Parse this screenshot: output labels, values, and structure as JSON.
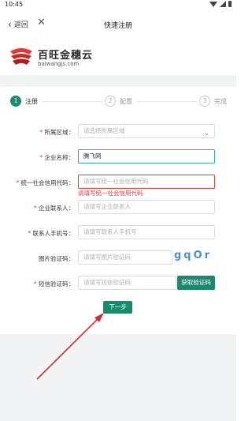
{
  "status": {
    "time": "10:45"
  },
  "nav": {
    "back_label": "返回",
    "close_glyph": "✕",
    "title": "快速注册"
  },
  "logo": {
    "name": "百旺金穗云",
    "domain": "baiwangjs.com"
  },
  "steps": [
    {
      "num": "1",
      "label": "注册",
      "active": true
    },
    {
      "num": "2",
      "label": "配置",
      "active": false
    },
    {
      "num": "3",
      "label": "完成",
      "active": false
    }
  ],
  "form": {
    "region": {
      "label": "所属区域：",
      "placeholder": "请选择所属区域"
    },
    "company": {
      "label": "企业名称：",
      "value": "腾飞网"
    },
    "credit_code": {
      "label": "统一社会信用代码：",
      "placeholder": "请填写统一社会信用代码",
      "error": "请填写统一社会信用代码"
    },
    "contact": {
      "label": "企业联系人：",
      "placeholder": "请填写企业联系人"
    },
    "phone": {
      "label": "联系人手机号：",
      "placeholder": "请填写联系人手机号"
    },
    "captcha": {
      "label": "图片验证码：",
      "placeholder": "请填写图片验证码",
      "image_text": "gqOr"
    },
    "sms": {
      "label": "短信验证码：",
      "placeholder": "请填写短信验证码",
      "button": "获取验证码"
    },
    "next": "下一步"
  },
  "colors": {
    "primary": "#1a8a6f",
    "error": "#e53935",
    "annotation": "#d32f2f"
  }
}
